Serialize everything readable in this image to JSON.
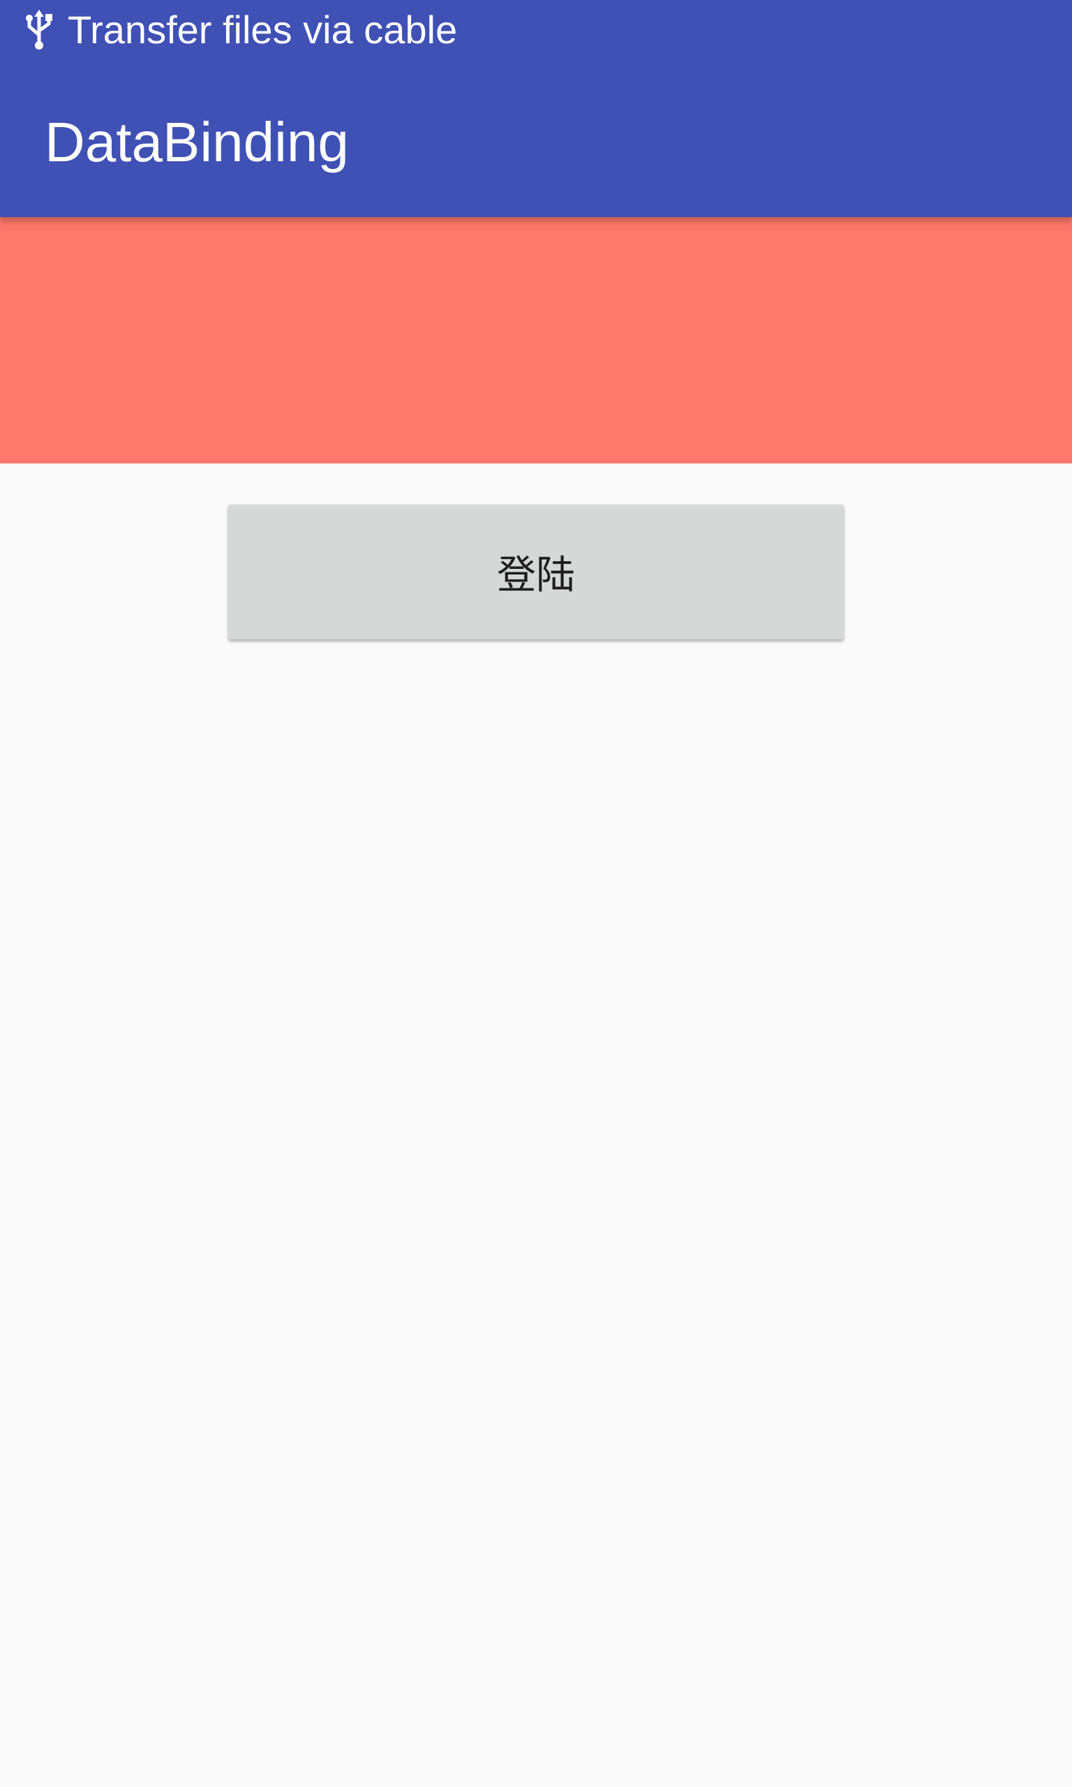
{
  "status_bar": {
    "icon": "usb-icon",
    "notification_text": "Transfer files via cable"
  },
  "app_bar": {
    "title": "DataBinding"
  },
  "main": {
    "login_button_label": "登陆"
  },
  "colors": {
    "app_bar": "#3f51b5",
    "banner": "#ff786b",
    "background": "#fafafa",
    "button": "#d6d7d7"
  }
}
